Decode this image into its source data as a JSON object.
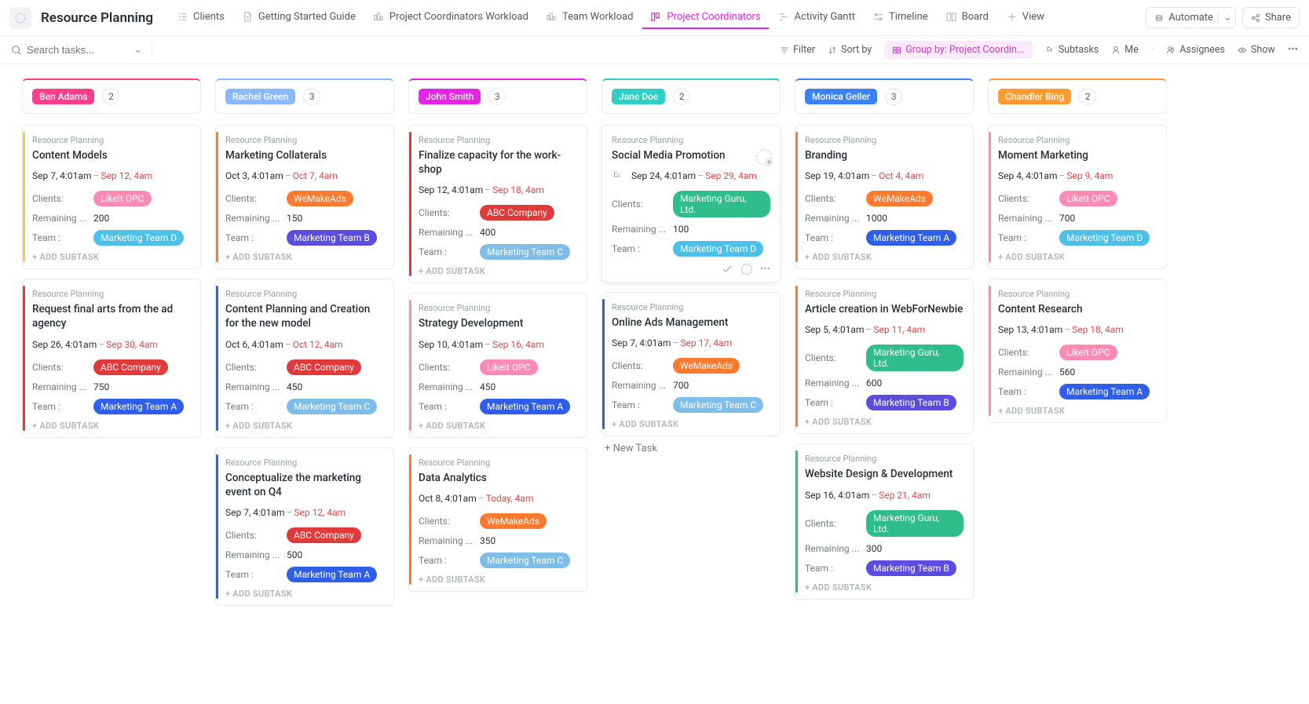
{
  "app_title": "Resource Planning",
  "views": [
    {
      "label": "Clients",
      "icon": "list"
    },
    {
      "label": "Getting Started Guide",
      "icon": "doc"
    },
    {
      "label": "Project Coordinators Workload",
      "icon": "workload"
    },
    {
      "label": "Team Workload",
      "icon": "workload"
    },
    {
      "label": "Project Coordinators",
      "icon": "board",
      "active": true
    },
    {
      "label": "Activity Gantt",
      "icon": "gantt"
    },
    {
      "label": "Timeline",
      "icon": "timeline"
    },
    {
      "label": "Board",
      "icon": "board-plain"
    },
    {
      "label": "View",
      "icon": "plus"
    }
  ],
  "automate_label": "Automate",
  "share_label": "Share",
  "search_placeholder": "Search tasks...",
  "toolbar": {
    "filter": "Filter",
    "sort": "Sort by",
    "group": "Group by: Project Coordin...",
    "subtasks": "Subtasks",
    "me": "Me",
    "assignees": "Assignees",
    "show": "Show"
  },
  "breadcrumb": "Resource Planning",
  "add_subtask": "+ ADD SUBTASK",
  "new_task": "+ New Task",
  "field_labels": {
    "clients": "Clients:",
    "remaining": "Remaining ...",
    "team": "Team :"
  },
  "clients": {
    "LikeIt OPC": {
      "bg": "#ff8ab4"
    },
    "WeMakeAds": {
      "bg": "#ff7a2e"
    },
    "ABC Company": {
      "bg": "#e03a3a"
    },
    "Marketing Guru, Ltd.": {
      "bg": "#2ebd8b"
    }
  },
  "teams": {
    "Marketing Team A": {
      "bg": "#2f5fea"
    },
    "Marketing Team B": {
      "bg": "#5b4de0"
    },
    "Marketing Team C": {
      "bg": "#7dbde8"
    },
    "Marketing Team D": {
      "bg": "#4cc0e8"
    }
  },
  "columns": [
    {
      "name": "Ben Adams",
      "color": "#ff3d8b",
      "count": "2",
      "cards": [
        {
          "accent": "#f7c948",
          "title": "Content Models",
          "start": "Sep 7, 4:01am",
          "end": "Sep 12, 4am",
          "client": "LikeIt OPC",
          "remaining": "200",
          "team": "Marketing Team D"
        },
        {
          "accent": "#e03a3a",
          "title": "Request final arts from the ad agency",
          "start": "Sep 26, 4:01am",
          "end": "Sep 30, 4am",
          "client": "ABC Company",
          "remaining": "750",
          "team": "Marketing Team A"
        }
      ]
    },
    {
      "name": "Rachel Green",
      "color": "#8ab8ff",
      "count": "3",
      "cards": [
        {
          "accent": "#ff7a2e",
          "title": "Marketing Collaterals",
          "start": "Oct 3, 4:01am",
          "end": "Oct 7, 4am",
          "client": "WeMakeAds",
          "remaining": "150",
          "team": "Marketing Team B"
        },
        {
          "accent": "#2f5fea",
          "title": "Content Planning and Creation for the new model",
          "start": "Oct 6, 4:01am",
          "end": "Oct 12, 4am",
          "client": "ABC Company",
          "remaining": "450",
          "team": "Marketing Team C"
        },
        {
          "accent": "#2f5fea",
          "title": "Conceptualize the marketing event on Q4",
          "start": "Sep 7, 4:01am",
          "end": "Sep 12, 4am",
          "client": "ABC Company",
          "remaining": "500",
          "team": "Marketing Team A"
        }
      ]
    },
    {
      "name": "John Smith",
      "color": "#e524e5",
      "count": "3",
      "cards": [
        {
          "accent": "#e03a3a",
          "title": "Finalize capacity for the work­shop",
          "start": "Sep 12, 4:01am",
          "end": "Sep 18, 4am",
          "client": "ABC Company",
          "remaining": "400",
          "team": "Marketing Team C"
        },
        {
          "accent": "#ff8ab4",
          "title": "Strategy Development",
          "start": "Sep 10, 4:01am",
          "end": "Sep 16, 4am",
          "client": "LikeIt OPC",
          "remaining": "450",
          "team": "Marketing Team A"
        },
        {
          "accent": "#ff7a2e",
          "title": "Data Analytics",
          "start": "Oct 8, 4:01am",
          "end": "Today, 4am",
          "client": "WeMakeAds",
          "remaining": "350",
          "team": "Marketing Team C"
        }
      ]
    },
    {
      "name": "Jane Doe",
      "color": "#2ed0c5",
      "count": "2",
      "cards": [
        {
          "hovered": true,
          "title": "Social Media Promotion",
          "start": "Sep 24, 4:01am",
          "end": "Sep 29, 4am",
          "client": "Marketing Guru, Ltd.",
          "remaining": "100",
          "team": "Marketing Team D",
          "has_subtask_icon": true
        },
        {
          "accent": "#2f5fea",
          "title": "Online Ads Management",
          "start": "Sep 7, 4:01am",
          "end": "Sep 17, 4am",
          "client": "WeMakeAds",
          "remaining": "700",
          "team": "Marketing Team C"
        }
      ],
      "show_new_task": true
    },
    {
      "name": "Monica Geller",
      "color": "#3b82f6",
      "count": "3",
      "cards": [
        {
          "accent": "#ff7a2e",
          "title": "Branding",
          "start": "Sep 19, 4:01am",
          "end": "Oct 4, 4am",
          "client": "WeMakeAds",
          "remaining": "1000",
          "team": "Marketing Team A"
        },
        {
          "accent": "#ff7a2e",
          "title": "Article creation in WebForNewbie",
          "start": "Sep 5, 4:01am",
          "end": "Sep 11, 4am",
          "client": "Marketing Guru, Ltd.",
          "remaining": "600",
          "team": "Marketing Team B"
        },
        {
          "accent": "#2ebd8b",
          "title": "Website Design & Development",
          "start": "Sep 16, 4:01am",
          "end": "Sep 21, 4am",
          "client": "Marketing Guru, Ltd.",
          "remaining": "300",
          "team": "Marketing Team B"
        }
      ]
    },
    {
      "name": "Chandler Bing",
      "color": "#ff9a2e",
      "count": "2",
      "cards": [
        {
          "accent": "#ff8ab4",
          "title": "Moment Marketing",
          "start": "Sep 4, 4:01am",
          "end": "Sep 9, 4am",
          "client": "LikeIt OPC",
          "remaining": "700",
          "team": "Marketing Team D"
        },
        {
          "accent": "#ff8ab4",
          "title": "Content Research",
          "start": "Sep 13, 4:01am",
          "end": "Sep 18, 4am",
          "client": "LikeIt OPC",
          "remaining": "560",
          "team": "Marketing Team A"
        }
      ]
    }
  ]
}
